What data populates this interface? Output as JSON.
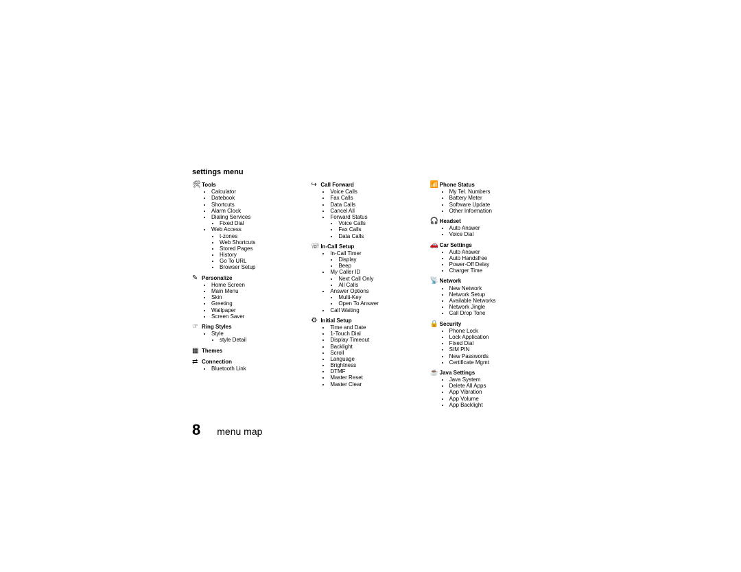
{
  "title": "settings menu",
  "page_number": "8",
  "footer_label": "menu map",
  "columns": [
    [
      {
        "icon": "🛠",
        "title": "Tools",
        "items": [
          {
            "label": "Calculator"
          },
          {
            "label": "Datebook"
          },
          {
            "label": "Shortcuts"
          },
          {
            "label": "Alarm Clock"
          },
          {
            "label": "Dialing Services",
            "children": [
              {
                "label": "Fixed Dial"
              }
            ]
          },
          {
            "label": "Web Access",
            "children": [
              {
                "label": "t-zones"
              },
              {
                "label": "Web Shortcuts"
              },
              {
                "label": "Stored Pages"
              },
              {
                "label": "History"
              },
              {
                "label": "Go To URL"
              },
              {
                "label": "Browser Setup"
              }
            ]
          }
        ]
      },
      {
        "icon": "✎",
        "title": "Personalize",
        "items": [
          {
            "label": "Home Screen"
          },
          {
            "label": "Main Menu"
          },
          {
            "label": "Skin"
          },
          {
            "label": "Greeting"
          },
          {
            "label": "Wallpaper"
          },
          {
            "label": "Screen Saver"
          }
        ]
      },
      {
        "icon": "☞",
        "title": "Ring Styles",
        "items": [
          {
            "label": "Style"
          },
          {
            "label": "style Detail",
            "children2": true,
            "children": []
          }
        ],
        "flat_items": [
          {
            "label": "Style",
            "children": [
              {
                "label": "style Detail"
              }
            ]
          }
        ]
      },
      {
        "icon": "▦",
        "title": "Themes",
        "items": []
      },
      {
        "icon": "⇄",
        "title": "Connection",
        "items": [
          {
            "label": "Bluetooth Link"
          }
        ]
      }
    ],
    [
      {
        "icon": "↪",
        "title": "Call Forward",
        "items": [
          {
            "label": "Voice Calls"
          },
          {
            "label": "Fax Calls"
          },
          {
            "label": "Data Calls"
          },
          {
            "label": "Cancel All"
          },
          {
            "label": "Forward Status",
            "children": [
              {
                "label": "Voice Calls"
              },
              {
                "label": "Fax Calls"
              },
              {
                "label": "Data Calls"
              }
            ]
          }
        ]
      },
      {
        "icon": "☏",
        "title": "In-Call Setup",
        "items": [
          {
            "label": "In-Call Timer",
            "children": [
              {
                "label": "Display"
              },
              {
                "label": "Beep"
              }
            ]
          },
          {
            "label": "My Caller ID",
            "children": [
              {
                "label": "Next Call Only"
              },
              {
                "label": "All Calls"
              }
            ]
          },
          {
            "label": "Answer Options",
            "children": [
              {
                "label": "Multi-Key"
              },
              {
                "label": "Open To Answer"
              }
            ]
          },
          {
            "label": "Call Waiting"
          }
        ]
      },
      {
        "icon": "⚙",
        "title": "Initial Setup",
        "items": [
          {
            "label": "Time and Date"
          },
          {
            "label": "1-Touch Dial"
          },
          {
            "label": "Display Timeout"
          },
          {
            "label": "Backlight"
          },
          {
            "label": "Scroll"
          },
          {
            "label": "Language"
          },
          {
            "label": "Brightness"
          },
          {
            "label": "DTMF"
          },
          {
            "label": "Master Reset"
          },
          {
            "label": "Master Clear"
          }
        ]
      }
    ],
    [
      {
        "icon": "📶",
        "title": "Phone Status",
        "items": [
          {
            "label": "My Tel. Numbers"
          },
          {
            "label": "Battery Meter"
          },
          {
            "label": "Software Update"
          },
          {
            "label": "Other Information"
          }
        ]
      },
      {
        "icon": "🎧",
        "title": "Headset",
        "items": [
          {
            "label": "Auto Answer"
          },
          {
            "label": "Voice Dial"
          }
        ]
      },
      {
        "icon": "🚗",
        "title": "Car Settings",
        "items": [
          {
            "label": "Auto Answer"
          },
          {
            "label": "Auto Handsfree"
          },
          {
            "label": "Power-Off Delay"
          },
          {
            "label": "Charger Time"
          }
        ]
      },
      {
        "icon": "📡",
        "title": "Network",
        "items": [
          {
            "label": "New Network"
          },
          {
            "label": "Network Setup"
          },
          {
            "label": "Available Networks"
          },
          {
            "label": "Network Jingle"
          },
          {
            "label": "Call Drop Tone"
          }
        ]
      },
      {
        "icon": "🔒",
        "title": "Security",
        "items": [
          {
            "label": "Phone Lock"
          },
          {
            "label": "Lock Application"
          },
          {
            "label": "Fixed Dial"
          },
          {
            "label": "SIM PIN"
          },
          {
            "label": "New Passwords"
          },
          {
            "label": "Certificate Mgmt"
          }
        ]
      },
      {
        "icon": "☕",
        "title": "Java Settings",
        "items": [
          {
            "label": "Java System"
          },
          {
            "label": "Delete All Apps"
          },
          {
            "label": "App Vibration"
          },
          {
            "label": "App Volume"
          },
          {
            "label": "App Backlight"
          }
        ]
      }
    ]
  ]
}
